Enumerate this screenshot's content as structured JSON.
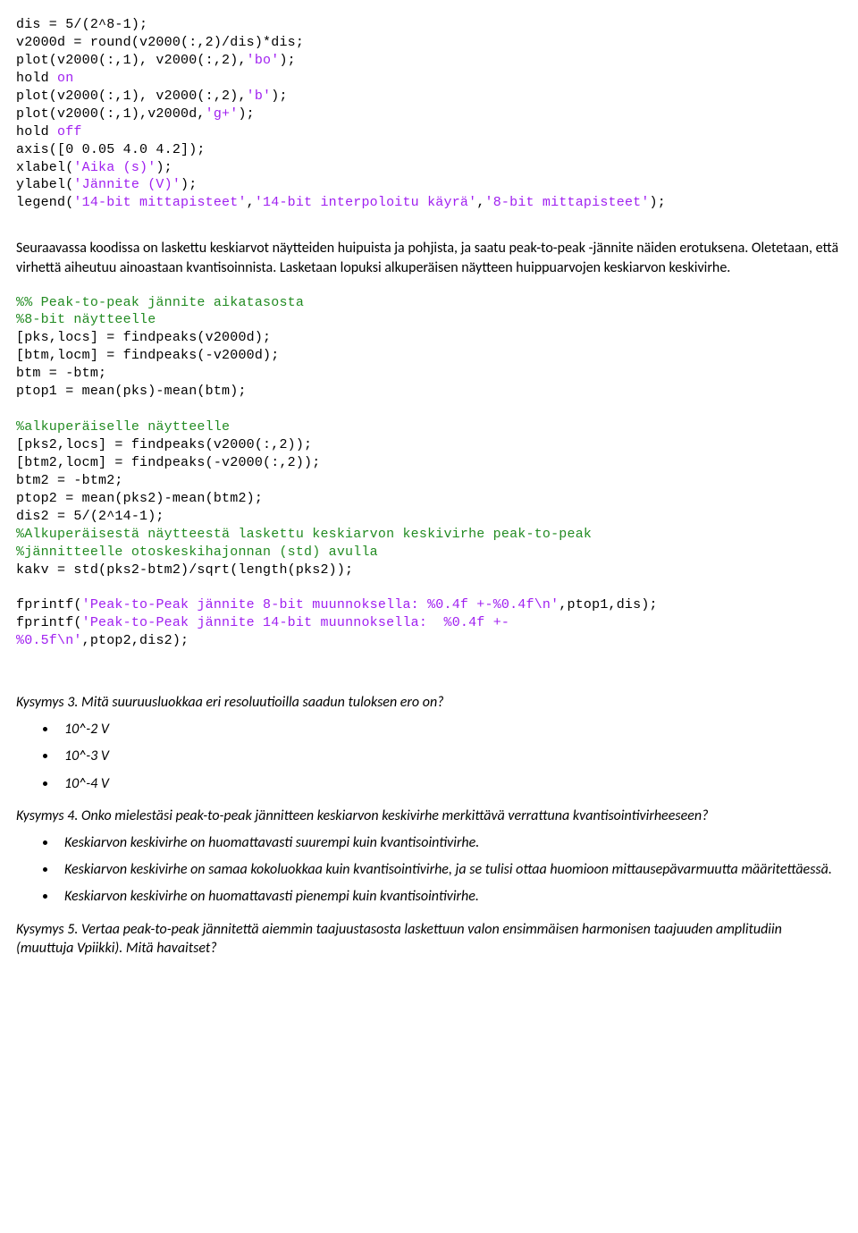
{
  "code1": {
    "l01a": "dis = 5/(2^8-1);",
    "l02a": "v2000d = round(v2000(:,2)/dis)*dis;",
    "l03a": "plot(v2000(:,1), v2000(:,2),",
    "l03b": "'bo'",
    "l03c": ");",
    "l04a": "hold ",
    "l04b": "on",
    "l05a": "plot(v2000(:,1), v2000(:,2),",
    "l05b": "'b'",
    "l05c": ");",
    "l06a": "plot(v2000(:,1),v2000d,",
    "l06b": "'g+'",
    "l06c": ");",
    "l07a": "hold ",
    "l07b": "off",
    "l08a": "axis([0 0.05 4.0 4.2]);",
    "l09a": "xlabel(",
    "l09b": "'Aika (s)'",
    "l09c": ");",
    "l10a": "ylabel(",
    "l10b": "'Jännite (V)'",
    "l10c": ");",
    "l11a": "legend(",
    "l11b": "'14-bit mittapisteet'",
    "l11c": ",",
    "l11d": "'14-bit interpoloitu käyrä'",
    "l11e": ",",
    "l11f": "'8-bit mittapisteet'",
    "l11g": ");"
  },
  "para1": {
    "t1": "Seuraavassa koodissa on laskettu keskiarvot näytteiden huipuista ja pohjista, ja saatu peak-to-peak -jännite näiden erotuksena. Oletetaan, että virhettä aiheutuu ainoastaan kvantisoinnista. Lasketaan lopuksi alkuperäisen näytteen huippuarvojen keskiarvon keskivirhe."
  },
  "code2": {
    "c01": "%% Peak-to-peak jännite aikatasosta",
    "c02": "%8-bit näytteelle",
    "l03": "[pks,locs] = findpeaks(v2000d);",
    "l04": "[btm,locm] = findpeaks(-v2000d);",
    "l05": "btm = -btm;",
    "l06": "ptop1 = mean(pks)-mean(btm);",
    "c07": "%alkuperäiselle näytteelle",
    "l08": "[pks2,locs] = findpeaks(v2000(:,2));",
    "l09": "[btm2,locm] = findpeaks(-v2000(:,2));",
    "l10": "btm2 = -btm2;",
    "l11": "ptop2 = mean(pks2)-mean(btm2);",
    "l12": "dis2 = 5/(2^14-1);",
    "c13": "%Alkuperäisestä näytteestä laskettu keskiarvon keskivirhe peak-to-peak",
    "c14": "%jännitteelle otoskeskihajonnan (std) avulla",
    "l15": "kakv = std(pks2-btm2)/sqrt(length(pks2));",
    "l17a": "fprintf(",
    "l17b": "'Peak-to-Peak jännite 8-bit muunnoksella: %0.4f +-%0.4f\\n'",
    "l17c": ",ptop1,dis);",
    "l18a": "fprintf(",
    "l18b": "'Peak-to-Peak jännite 14-bit muunnoksella:  %0.4f +-",
    "l18c": "%0.5f\\n'",
    "l18d": ",ptop2,dis2);"
  },
  "q3": {
    "title": "Kysymys 3. Mitä suuruusluokkaa eri resoluutioilla saadun tuloksen ero on?",
    "opt1": "10^-2 V",
    "opt2": "10^-3 V",
    "opt3": "10^-4 V"
  },
  "q4": {
    "title": "Kysymys 4. Onko mielestäsi peak-to-peak jännitteen keskiarvon keskivirhe merkittävä verrattuna kvantisointivirheeseen?",
    "opt1": "Keskiarvon keskivirhe on huomattavasti suurempi kuin kvantisointivirhe.",
    "opt2": "Keskiarvon keskivirhe on samaa kokoluokkaa kuin kvantisointivirhe, ja se tulisi ottaa huomioon mittausepävarmuutta määritettäessä.",
    "opt3": "Keskiarvon keskivirhe on huomattavasti pienempi kuin kvantisointivirhe."
  },
  "q5": {
    "title": "Kysymys 5. Vertaa peak-to-peak jännitettä aiemmin taajuustasosta laskettuun valon ensimmäisen harmonisen taajuuden amplitudiin (muuttuja Vpiikki). Mitä havaitset?"
  }
}
